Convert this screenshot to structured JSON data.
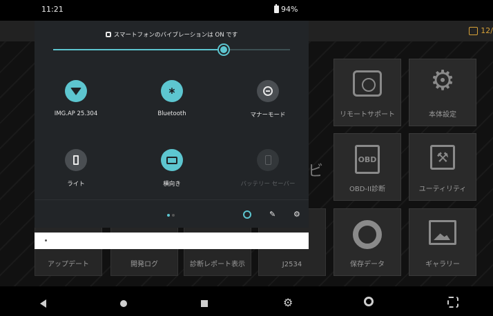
{
  "status_bar": {
    "time": "11:21",
    "battery": "94%"
  },
  "app": {
    "date_fragment": "12/",
    "tiles": [
      {
        "id": "remote",
        "label": "リモートサポート"
      },
      {
        "id": "settings",
        "label": "本体設定"
      },
      {
        "id": "obd",
        "label": "OBD-II診断",
        "icon_text": "OBD"
      },
      {
        "id": "utility",
        "label": "ユーティリティ"
      },
      {
        "id": "save",
        "label": "保存データ"
      },
      {
        "id": "gallery",
        "label": "ギャラリー"
      }
    ],
    "bottom_tiles": [
      {
        "id": "update",
        "label": "アップデート"
      },
      {
        "id": "devlog",
        "label": "開発ログ"
      },
      {
        "id": "report",
        "label": "診断レポート表示"
      },
      {
        "id": "j2534",
        "label": "J2534"
      }
    ],
    "partial_char": "ビ"
  },
  "shade": {
    "vibration_text": "スマートフォンのバイブレーションは ON です",
    "brightness_level_percent": 72,
    "tiles": [
      {
        "id": "wifi",
        "label": "IMG.AP 25.304",
        "state": "on",
        "icon": "wifi-icon"
      },
      {
        "id": "bluetooth",
        "label": "Bluetooth",
        "state": "on",
        "icon": "bluetooth-icon"
      },
      {
        "id": "dnd",
        "label": "マナーモード",
        "state": "off",
        "icon": "do-not-disturb-icon"
      },
      {
        "id": "flashlight",
        "label": "ライト",
        "state": "off",
        "icon": "flashlight-icon"
      },
      {
        "id": "rotate",
        "label": "横向き",
        "state": "on",
        "icon": "rotate-icon"
      },
      {
        "id": "battery_saver",
        "label": "バッテリー セーバー",
        "state": "disabled",
        "icon": "battery-saver-icon"
      }
    ]
  },
  "notification": {
    "text": "•"
  },
  "colors": {
    "accent": "#5dc6d0",
    "shade_bg": "#222528",
    "date_orange": "#d8a238"
  }
}
